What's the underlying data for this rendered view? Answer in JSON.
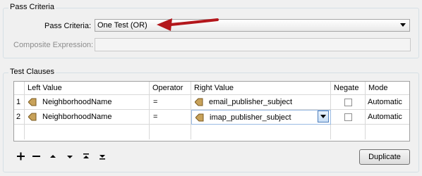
{
  "pass_criteria_group": {
    "title": "Pass Criteria",
    "pass_criteria_label": "Pass Criteria:",
    "pass_criteria_value": "One Test (OR)",
    "composite_label": "Composite Expression:",
    "composite_value": ""
  },
  "test_clauses_group": {
    "title": "Test Clauses",
    "columns": [
      "Left Value",
      "Operator",
      "Right Value",
      "Negate",
      "Mode"
    ],
    "rows": [
      {
        "num": "1",
        "left": "NeighborhoodName",
        "operator": "=",
        "right": "email_publisher_subject",
        "negate": false,
        "mode": "Automatic"
      },
      {
        "num": "2",
        "left": "NeighborhoodName",
        "operator": "=",
        "right": "imap_publisher_subject",
        "negate": false,
        "mode": "Automatic"
      }
    ]
  },
  "toolbar": {
    "icons": [
      "add-icon",
      "remove-icon",
      "move-up-icon",
      "move-down-icon",
      "move-top-icon",
      "move-bottom-icon"
    ],
    "duplicate_label": "Duplicate"
  },
  "colors": {
    "annotation_arrow": "#b3171c",
    "param_icon": "#c8a25a"
  }
}
